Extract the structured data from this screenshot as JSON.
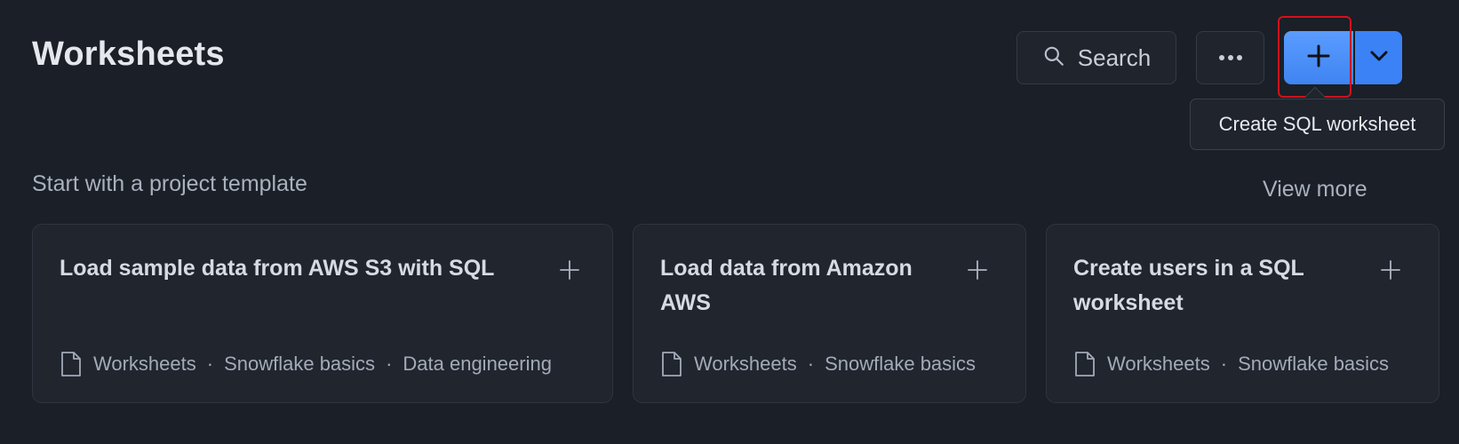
{
  "header": {
    "title": "Worksheets",
    "search_label": "Search",
    "more_icon": "ellipsis-icon",
    "create_icon": "plus-icon",
    "dropdown_icon": "chevron-down-icon",
    "tooltip": "Create SQL worksheet"
  },
  "templates": {
    "heading": "Start with a project template",
    "view_more": "View more",
    "cards": [
      {
        "title": "Load sample data from AWS S3 with SQL",
        "tags": [
          "Worksheets",
          "Snowflake basics",
          "Data engineering"
        ]
      },
      {
        "title": "Load data from Amazon AWS",
        "tags": [
          "Worksheets",
          "Snowflake basics"
        ]
      },
      {
        "title": "Create users in a SQL worksheet",
        "tags": [
          "Worksheets",
          "Snowflake basics"
        ]
      }
    ]
  },
  "colors": {
    "background": "#1b1f27",
    "card": "#20252e",
    "accent": "#3b82f6",
    "focus_ring": "#d0121b"
  }
}
